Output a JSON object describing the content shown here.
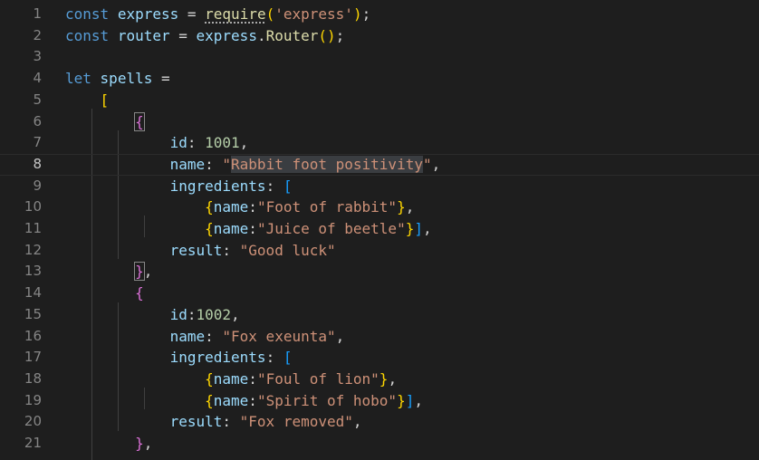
{
  "editor": {
    "current_line": 8,
    "lines": [
      {
        "n": "1",
        "tokens": [
          [
            "kw",
            "const"
          ],
          [
            "punc",
            " "
          ],
          [
            "var",
            "express"
          ],
          [
            "punc",
            " = "
          ],
          [
            "fn",
            "require"
          ],
          [
            "b1",
            "("
          ],
          [
            "str",
            "'express'"
          ],
          [
            "b1",
            ")"
          ],
          [
            "punc",
            ";"
          ]
        ]
      },
      {
        "n": "2",
        "tokens": [
          [
            "kw",
            "const"
          ],
          [
            "punc",
            " "
          ],
          [
            "var",
            "router"
          ],
          [
            "punc",
            " = "
          ],
          [
            "var",
            "express"
          ],
          [
            "punc",
            "."
          ],
          [
            "fn",
            "Router"
          ],
          [
            "b1",
            "()"
          ],
          [
            "punc",
            ";"
          ]
        ]
      },
      {
        "n": "3",
        "tokens": []
      },
      {
        "n": "4",
        "tokens": [
          [
            "kw",
            "let"
          ],
          [
            "punc",
            " "
          ],
          [
            "var",
            "spells"
          ],
          [
            "punc",
            " ="
          ]
        ]
      },
      {
        "n": "5",
        "tokens": [
          [
            "punc",
            "    "
          ],
          [
            "b1",
            "["
          ]
        ]
      },
      {
        "n": "6",
        "tokens": [
          [
            "punc",
            "        "
          ],
          [
            "b2",
            "{"
          ]
        ]
      },
      {
        "n": "7",
        "tokens": [
          [
            "punc",
            "            "
          ],
          [
            "var",
            "id"
          ],
          [
            "punc",
            ": "
          ],
          [
            "num",
            "1001"
          ],
          [
            "punc",
            ","
          ]
        ]
      },
      {
        "n": "8",
        "tokens": [
          [
            "punc",
            "            "
          ],
          [
            "var",
            "name"
          ],
          [
            "punc",
            ": "
          ],
          [
            "str",
            "\""
          ],
          [
            "strsel",
            "Rabbit foot positiv"
          ],
          [
            "cursor",
            ""
          ],
          [
            "strsel",
            "ity"
          ],
          [
            "str",
            "\""
          ],
          [
            "punc",
            ","
          ]
        ]
      },
      {
        "n": "9",
        "tokens": [
          [
            "punc",
            "            "
          ],
          [
            "var",
            "ingredients"
          ],
          [
            "punc",
            ": "
          ],
          [
            "b3",
            "["
          ]
        ]
      },
      {
        "n": "10",
        "tokens": [
          [
            "punc",
            "                "
          ],
          [
            "b1",
            "{"
          ],
          [
            "var",
            "name"
          ],
          [
            "punc",
            ":"
          ],
          [
            "str",
            "\"Foot of rabbit\""
          ],
          [
            "b1",
            "}"
          ],
          [
            "punc",
            ","
          ]
        ]
      },
      {
        "n": "11",
        "tokens": [
          [
            "punc",
            "                "
          ],
          [
            "b1",
            "{"
          ],
          [
            "var",
            "name"
          ],
          [
            "punc",
            ":"
          ],
          [
            "str",
            "\"Juice of beetle\""
          ],
          [
            "b1",
            "}"
          ],
          [
            "b3",
            "]"
          ],
          [
            "punc",
            ","
          ]
        ]
      },
      {
        "n": "12",
        "tokens": [
          [
            "punc",
            "            "
          ],
          [
            "var",
            "result"
          ],
          [
            "punc",
            ": "
          ],
          [
            "str",
            "\"Good luck\""
          ]
        ]
      },
      {
        "n": "13",
        "tokens": [
          [
            "punc",
            "        "
          ],
          [
            "b2",
            "}"
          ],
          [
            "punc",
            ","
          ]
        ]
      },
      {
        "n": "14",
        "tokens": [
          [
            "punc",
            "        "
          ],
          [
            "b2",
            "{"
          ]
        ]
      },
      {
        "n": "15",
        "tokens": [
          [
            "punc",
            "            "
          ],
          [
            "var",
            "id"
          ],
          [
            "punc",
            ":"
          ],
          [
            "num",
            "1002"
          ],
          [
            "punc",
            ","
          ]
        ]
      },
      {
        "n": "16",
        "tokens": [
          [
            "punc",
            "            "
          ],
          [
            "var",
            "name"
          ],
          [
            "punc",
            ": "
          ],
          [
            "str",
            "\"Fox exeunta\""
          ],
          [
            "punc",
            ","
          ]
        ]
      },
      {
        "n": "17",
        "tokens": [
          [
            "punc",
            "            "
          ],
          [
            "var",
            "ingredients"
          ],
          [
            "punc",
            ": "
          ],
          [
            "b3",
            "["
          ]
        ]
      },
      {
        "n": "18",
        "tokens": [
          [
            "punc",
            "                "
          ],
          [
            "b1",
            "{"
          ],
          [
            "var",
            "name"
          ],
          [
            "punc",
            ":"
          ],
          [
            "str",
            "\"Foul of lion\""
          ],
          [
            "b1",
            "}"
          ],
          [
            "punc",
            ","
          ]
        ]
      },
      {
        "n": "19",
        "tokens": [
          [
            "punc",
            "                "
          ],
          [
            "b1",
            "{"
          ],
          [
            "var",
            "name"
          ],
          [
            "punc",
            ":"
          ],
          [
            "str",
            "\"Spirit of hobo\""
          ],
          [
            "b1",
            "}"
          ],
          [
            "b3",
            "]"
          ],
          [
            "punc",
            ","
          ]
        ]
      },
      {
        "n": "20",
        "tokens": [
          [
            "punc",
            "            "
          ],
          [
            "var",
            "result"
          ],
          [
            "punc",
            ": "
          ],
          [
            "str",
            "\"Fox removed\""
          ],
          [
            "punc",
            ","
          ]
        ]
      },
      {
        "n": "21",
        "tokens": [
          [
            "punc",
            "        "
          ],
          [
            "b2",
            "}"
          ],
          [
            "punc",
            ","
          ]
        ]
      }
    ]
  }
}
